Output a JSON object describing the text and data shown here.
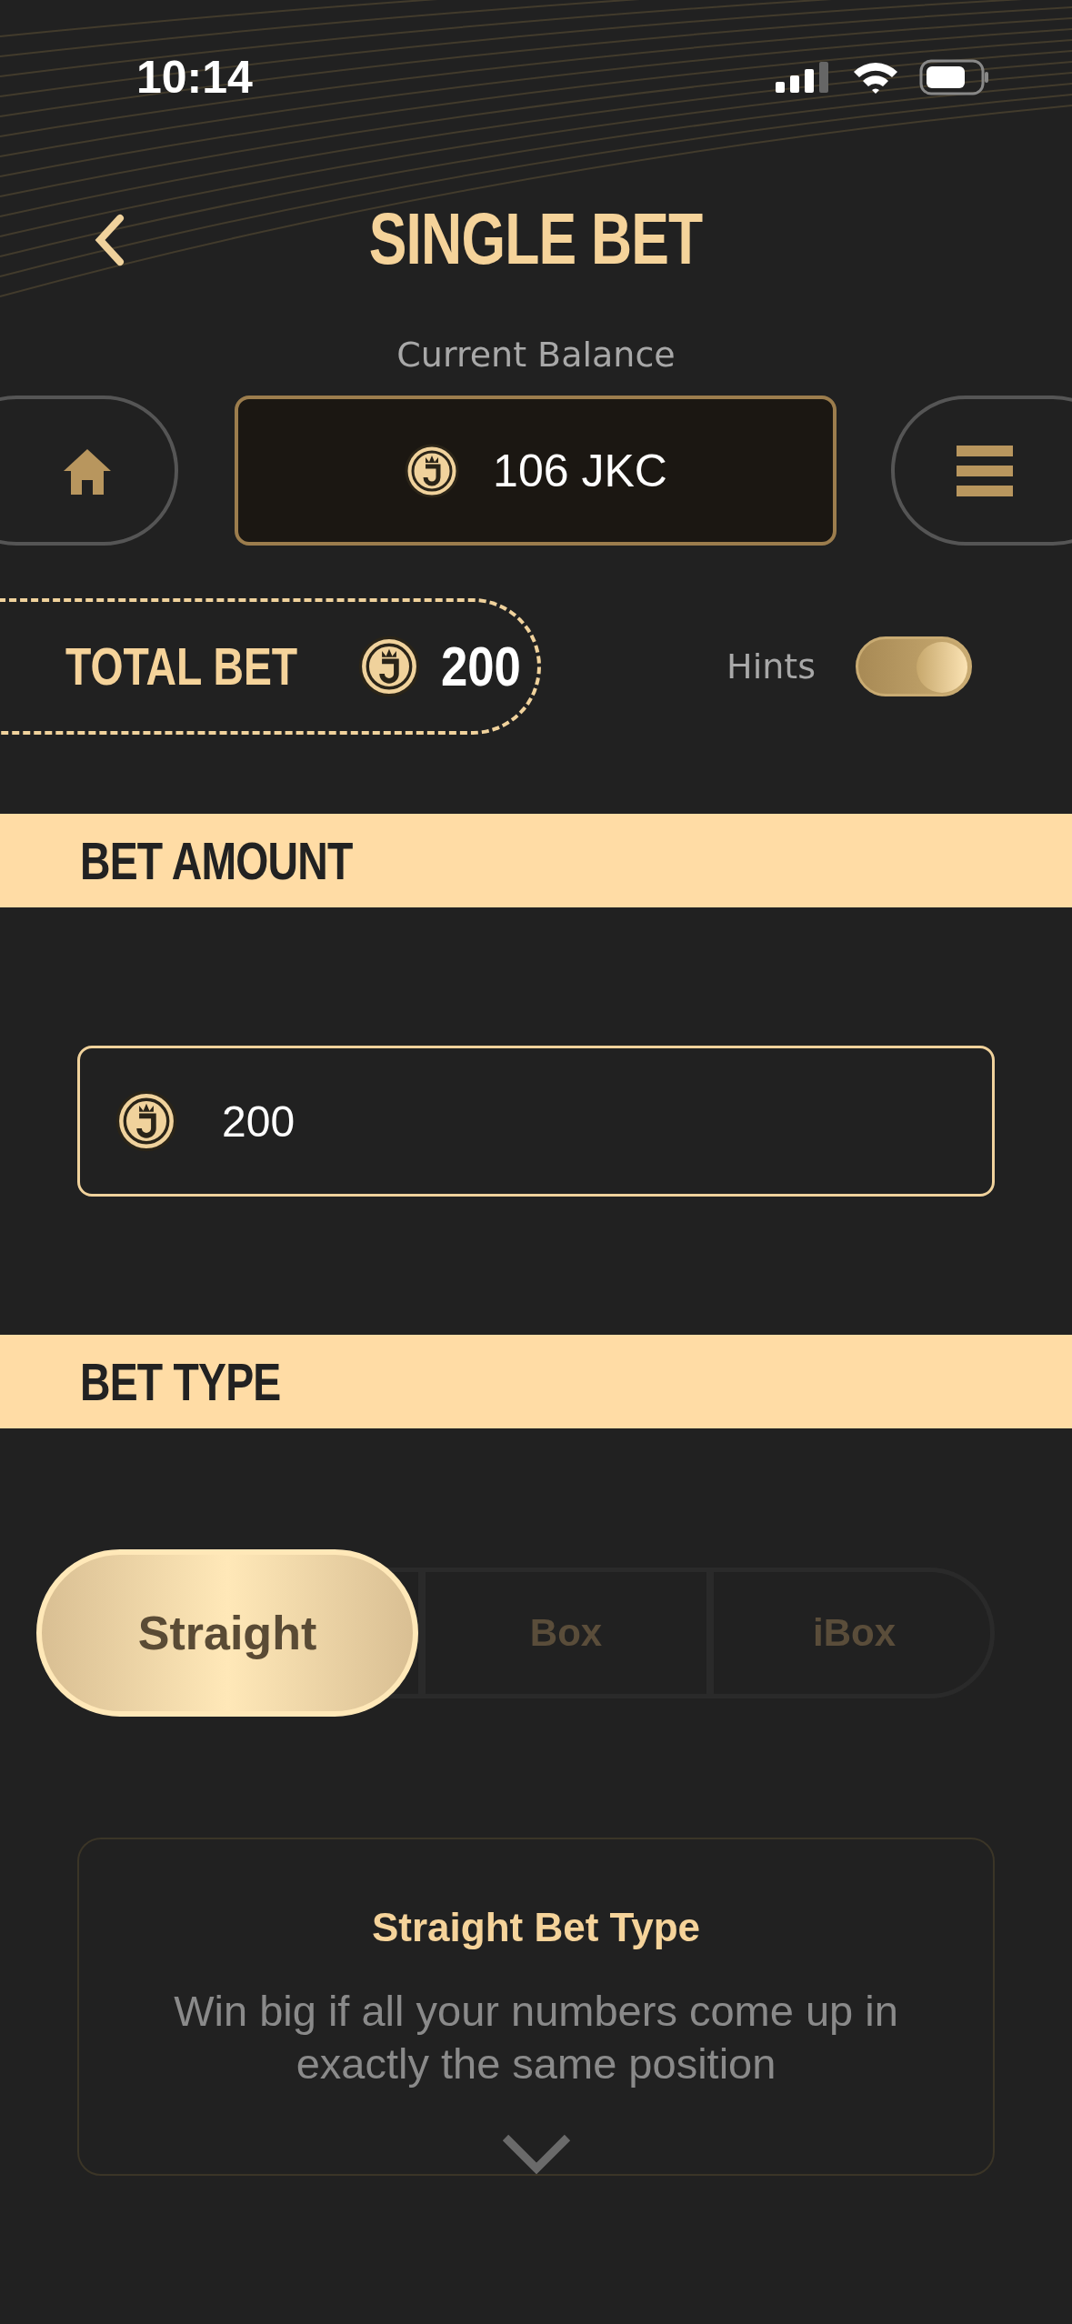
{
  "status_bar": {
    "time": "10:14"
  },
  "header": {
    "title": "SINGLE BET"
  },
  "balance": {
    "label": "Current Balance",
    "value": "106 JKC"
  },
  "total_bet": {
    "label": "TOTAL BET",
    "amount": "200"
  },
  "hints": {
    "label": "Hints",
    "on": true
  },
  "bet_amount": {
    "heading": "BET AMOUNT",
    "value": "200"
  },
  "bet_type": {
    "heading": "BET TYPE",
    "options": [
      {
        "label": "Straight",
        "selected": true
      },
      {
        "label": "Box",
        "selected": false
      },
      {
        "label": "iBox",
        "selected": false
      }
    ],
    "info": {
      "title": "Straight Bet Type",
      "text": "Win big if all your numbers come up in exactly the same position"
    }
  }
}
